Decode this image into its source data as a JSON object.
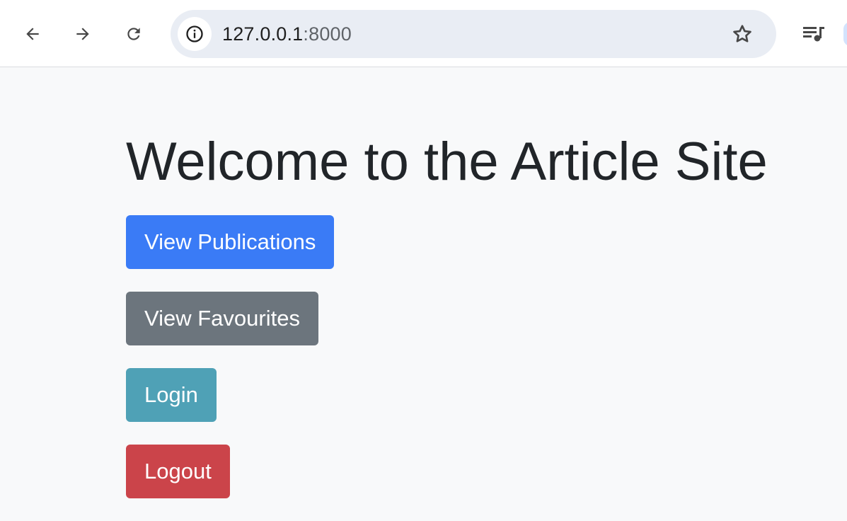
{
  "browser": {
    "url_host": "127.0.0.1",
    "url_port": ":8000",
    "icons": {
      "back": "arrow-left-icon",
      "forward": "arrow-right-icon",
      "reload": "reload-icon",
      "site_info": "info-icon",
      "bookmark": "star-icon",
      "media": "media-queue-icon"
    }
  },
  "page": {
    "title": "Welcome to the Article Site",
    "buttons": {
      "publications": "View Publications",
      "favourites": "View Favourites",
      "login": "Login",
      "logout": "Logout"
    }
  },
  "colors": {
    "page_background": "#f8f9fa",
    "primary": "#3a7bf6",
    "secondary": "#6c757d",
    "info": "#4fa1b6",
    "danger": "#cb444a"
  }
}
